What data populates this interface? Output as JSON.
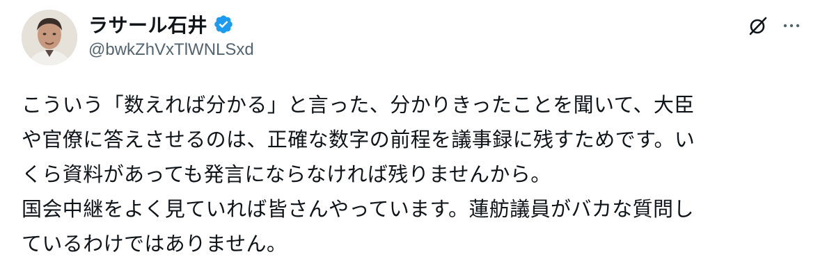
{
  "author": {
    "display_name": "ラサール石井",
    "handle": "@bwkZhVxTlWNLSxd",
    "verified": true,
    "verified_color": "#1d9bf0"
  },
  "actions": {
    "grok_icon": "grok-icon",
    "more_icon": "more-icon"
  },
  "tweet": {
    "lines": [
      "こういう「数えれば分かる」と言った、分かりきったことを聞いて、大臣",
      "や官僚に答えさせるのは、正確な数字の前程を議事録に残すためです。い",
      "くら資料があっても発言にならなければ残りませんから。",
      "国会中継をよく見ていれば皆さんやっています。蓮舫議員がバカな質問し",
      "ているわけではありません。"
    ]
  }
}
